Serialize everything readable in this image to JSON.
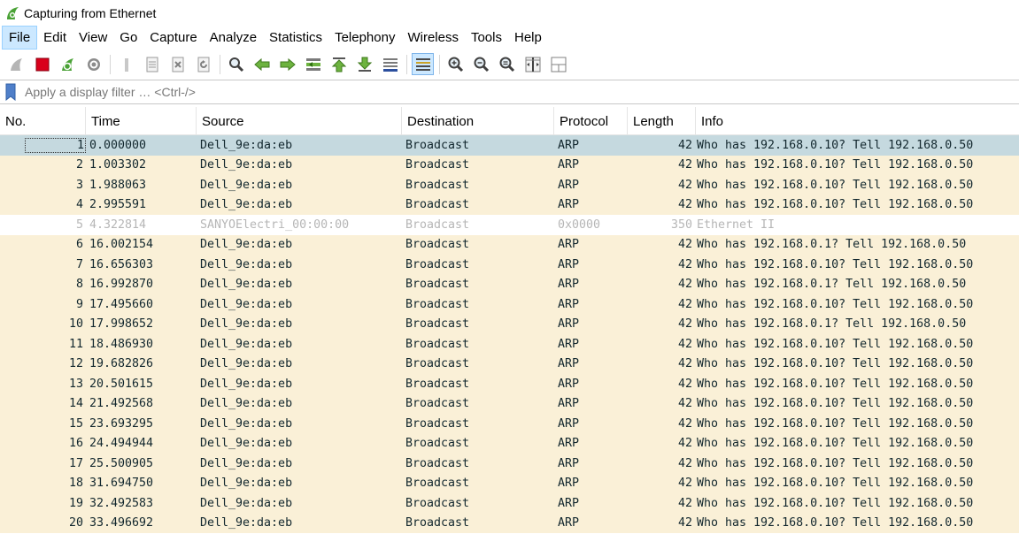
{
  "window": {
    "title": "Capturing from Ethernet"
  },
  "menu": [
    "File",
    "Edit",
    "View",
    "Go",
    "Capture",
    "Analyze",
    "Statistics",
    "Telephony",
    "Wireless",
    "Tools",
    "Help"
  ],
  "filter": {
    "placeholder": "Apply a display filter … <Ctrl-/>"
  },
  "columns": [
    "No.",
    "Time",
    "Source",
    "Destination",
    "Protocol",
    "Length",
    "Info"
  ],
  "colors": {
    "arp_row": "#faf0d7",
    "selected_row": "#c5d9df",
    "menu_active": "#cce8ff",
    "stop_red": "#d9001b",
    "shark_green": "#4aa236"
  },
  "toolbar_icons": [
    "shark-fin-start-icon",
    "stop-capture-icon",
    "restart-capture-icon",
    "capture-options-icon",
    "open-file-icon",
    "save-file-icon",
    "close-file-icon",
    "reload-file-icon",
    "find-packet-icon",
    "go-back-icon",
    "go-forward-icon",
    "go-to-packet-icon",
    "go-first-packet-icon",
    "go-last-packet-icon",
    "auto-scroll-icon",
    "colorize-icon",
    "zoom-in-icon",
    "zoom-out-icon",
    "zoom-normal-icon",
    "resize-columns-icon",
    "layout-icon"
  ],
  "packets": [
    {
      "no": "1",
      "time": "0.000000",
      "src": "Dell_9e:da:eb",
      "dst": "Broadcast",
      "proto": "ARP",
      "len": "42",
      "info": "Who has 192.168.0.10? Tell 192.168.0.50",
      "kind": "selected"
    },
    {
      "no": "2",
      "time": "1.003302",
      "src": "Dell_9e:da:eb",
      "dst": "Broadcast",
      "proto": "ARP",
      "len": "42",
      "info": "Who has 192.168.0.10? Tell 192.168.0.50",
      "kind": "arp"
    },
    {
      "no": "3",
      "time": "1.988063",
      "src": "Dell_9e:da:eb",
      "dst": "Broadcast",
      "proto": "ARP",
      "len": "42",
      "info": "Who has 192.168.0.10? Tell 192.168.0.50",
      "kind": "arp"
    },
    {
      "no": "4",
      "time": "2.995591",
      "src": "Dell_9e:da:eb",
      "dst": "Broadcast",
      "proto": "ARP",
      "len": "42",
      "info": "Who has 192.168.0.10? Tell 192.168.0.50",
      "kind": "arp"
    },
    {
      "no": "5",
      "time": "4.322814",
      "src": "SANYOElectri_00:00:00",
      "dst": "Broadcast",
      "proto": "0x0000",
      "len": "350",
      "info": "Ethernet II",
      "kind": "other"
    },
    {
      "no": "6",
      "time": "16.002154",
      "src": "Dell_9e:da:eb",
      "dst": "Broadcast",
      "proto": "ARP",
      "len": "42",
      "info": "Who has 192.168.0.1? Tell 192.168.0.50",
      "kind": "arp"
    },
    {
      "no": "7",
      "time": "16.656303",
      "src": "Dell_9e:da:eb",
      "dst": "Broadcast",
      "proto": "ARP",
      "len": "42",
      "info": "Who has 192.168.0.10? Tell 192.168.0.50",
      "kind": "arp"
    },
    {
      "no": "8",
      "time": "16.992870",
      "src": "Dell_9e:da:eb",
      "dst": "Broadcast",
      "proto": "ARP",
      "len": "42",
      "info": "Who has 192.168.0.1? Tell 192.168.0.50",
      "kind": "arp"
    },
    {
      "no": "9",
      "time": "17.495660",
      "src": "Dell_9e:da:eb",
      "dst": "Broadcast",
      "proto": "ARP",
      "len": "42",
      "info": "Who has 192.168.0.10? Tell 192.168.0.50",
      "kind": "arp"
    },
    {
      "no": "10",
      "time": "17.998652",
      "src": "Dell_9e:da:eb",
      "dst": "Broadcast",
      "proto": "ARP",
      "len": "42",
      "info": "Who has 192.168.0.1? Tell 192.168.0.50",
      "kind": "arp"
    },
    {
      "no": "11",
      "time": "18.486930",
      "src": "Dell_9e:da:eb",
      "dst": "Broadcast",
      "proto": "ARP",
      "len": "42",
      "info": "Who has 192.168.0.10? Tell 192.168.0.50",
      "kind": "arp"
    },
    {
      "no": "12",
      "time": "19.682826",
      "src": "Dell_9e:da:eb",
      "dst": "Broadcast",
      "proto": "ARP",
      "len": "42",
      "info": "Who has 192.168.0.10? Tell 192.168.0.50",
      "kind": "arp"
    },
    {
      "no": "13",
      "time": "20.501615",
      "src": "Dell_9e:da:eb",
      "dst": "Broadcast",
      "proto": "ARP",
      "len": "42",
      "info": "Who has 192.168.0.10? Tell 192.168.0.50",
      "kind": "arp"
    },
    {
      "no": "14",
      "time": "21.492568",
      "src": "Dell_9e:da:eb",
      "dst": "Broadcast",
      "proto": "ARP",
      "len": "42",
      "info": "Who has 192.168.0.10? Tell 192.168.0.50",
      "kind": "arp"
    },
    {
      "no": "15",
      "time": "23.693295",
      "src": "Dell_9e:da:eb",
      "dst": "Broadcast",
      "proto": "ARP",
      "len": "42",
      "info": "Who has 192.168.0.10? Tell 192.168.0.50",
      "kind": "arp"
    },
    {
      "no": "16",
      "time": "24.494944",
      "src": "Dell_9e:da:eb",
      "dst": "Broadcast",
      "proto": "ARP",
      "len": "42",
      "info": "Who has 192.168.0.10? Tell 192.168.0.50",
      "kind": "arp"
    },
    {
      "no": "17",
      "time": "25.500905",
      "src": "Dell_9e:da:eb",
      "dst": "Broadcast",
      "proto": "ARP",
      "len": "42",
      "info": "Who has 192.168.0.10? Tell 192.168.0.50",
      "kind": "arp"
    },
    {
      "no": "18",
      "time": "31.694750",
      "src": "Dell_9e:da:eb",
      "dst": "Broadcast",
      "proto": "ARP",
      "len": "42",
      "info": "Who has 192.168.0.10? Tell 192.168.0.50",
      "kind": "arp"
    },
    {
      "no": "19",
      "time": "32.492583",
      "src": "Dell_9e:da:eb",
      "dst": "Broadcast",
      "proto": "ARP",
      "len": "42",
      "info": "Who has 192.168.0.10? Tell 192.168.0.50",
      "kind": "arp"
    },
    {
      "no": "20",
      "time": "33.496692",
      "src": "Dell_9e:da:eb",
      "dst": "Broadcast",
      "proto": "ARP",
      "len": "42",
      "info": "Who has 192.168.0.10? Tell 192.168.0.50",
      "kind": "arp"
    }
  ]
}
